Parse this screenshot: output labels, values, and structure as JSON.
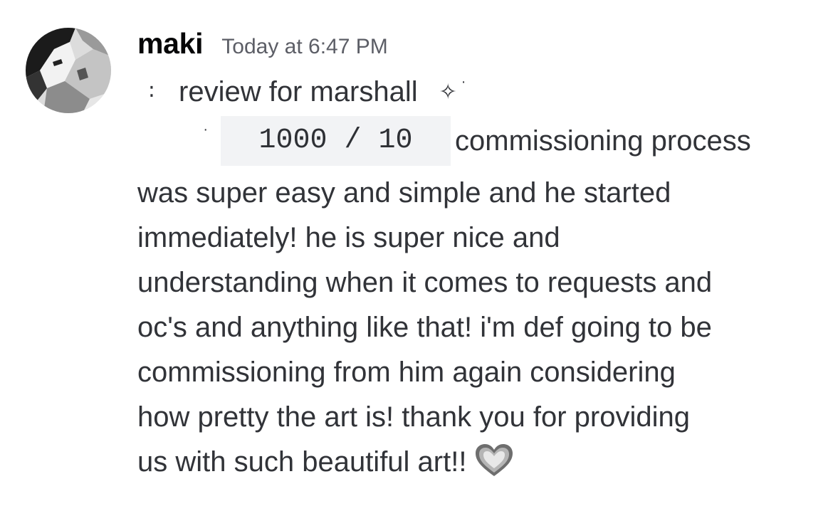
{
  "message": {
    "username": "maki",
    "timestamp": "Today at 6:47 PM",
    "line1": {
      "prefix_glyph": "∶",
      "text": "review for marshall",
      "sparkle_glyph": "✧",
      "sparkle_dot": "·"
    },
    "line2": {
      "prefix_glyph": "·",
      "code": "1000 / 10",
      "text": "commissioning process"
    },
    "body_lines": [
      "was super easy and simple and he started",
      "immediately! he is super nice and",
      "understanding when it comes to requests and",
      "oc's and anything like that! i'm def going to be",
      "commissioning from him again considering",
      "how pretty the art is! thank you for providing",
      "us with such beautiful art!!"
    ],
    "end_icon": "grey-heart-icon"
  },
  "colors": {
    "background": "#ffffff",
    "username": "#060607",
    "timestamp": "#5c5e66",
    "text": "#313338",
    "code_background": "#f2f3f5"
  }
}
